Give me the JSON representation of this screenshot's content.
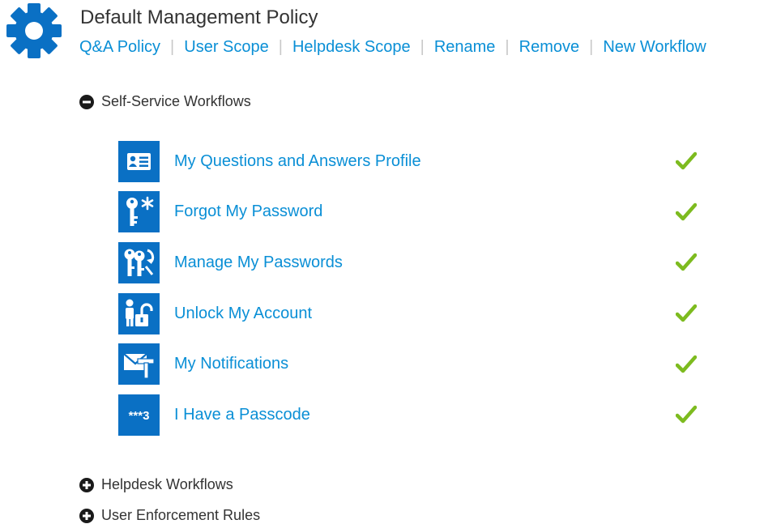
{
  "policy": {
    "title": "Default Management Policy",
    "icon": "gear-icon"
  },
  "actions": [
    {
      "label": "Q&A Policy"
    },
    {
      "label": "User Scope"
    },
    {
      "label": "Helpdesk Scope"
    },
    {
      "label": "Rename"
    },
    {
      "label": "Remove"
    },
    {
      "label": "New Workflow"
    }
  ],
  "separator": "|",
  "sections": {
    "self_service": {
      "label": "Self-Service Workflows",
      "state": "expanded",
      "icon": "minus-circle-icon"
    },
    "helpdesk": {
      "label": "Helpdesk Workflows",
      "state": "collapsed",
      "icon": "plus-circle-icon"
    },
    "enforcement": {
      "label": "User Enforcement Rules",
      "state": "collapsed",
      "icon": "plus-circle-icon"
    }
  },
  "workflows": [
    {
      "label": "My Questions and Answers Profile",
      "icon": "id-card-icon",
      "enabled": true
    },
    {
      "label": "Forgot My Password",
      "icon": "key-asterisk-icon",
      "enabled": true
    },
    {
      "label": "Manage My Passwords",
      "icon": "keys-refresh-icon",
      "enabled": true
    },
    {
      "label": "Unlock My Account",
      "icon": "user-unlock-icon",
      "enabled": true
    },
    {
      "label": "My Notifications",
      "icon": "envelope-hammer-icon",
      "enabled": true
    },
    {
      "label": "I Have a Passcode",
      "icon": "passcode-icon",
      "enabled": true,
      "icon_text": "***3"
    }
  ],
  "colors": {
    "link": "#0a8fd6",
    "icon_bg": "#0a70c4",
    "gear": "#0a70c4",
    "check": "#7dbb1f",
    "text": "#333333",
    "separator": "#c8c8c8"
  }
}
